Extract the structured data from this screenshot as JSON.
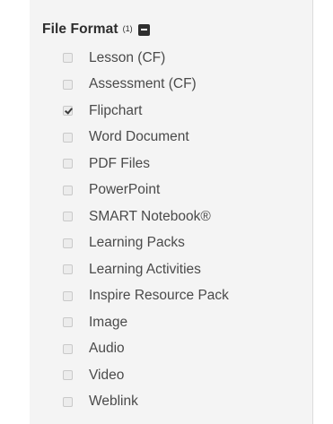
{
  "filter": {
    "title": "File Format",
    "count": "(1)",
    "collapse_icon": "minus-square-icon",
    "options": [
      {
        "label": "Lesson (CF)",
        "checked": false
      },
      {
        "label": "Assessment (CF)",
        "checked": false
      },
      {
        "label": "Flipchart",
        "checked": true
      },
      {
        "label": "Word Document",
        "checked": false
      },
      {
        "label": "PDF Files",
        "checked": false
      },
      {
        "label": "PowerPoint",
        "checked": false
      },
      {
        "label": "SMART Notebook®",
        "checked": false
      },
      {
        "label": "Learning Packs",
        "checked": false
      },
      {
        "label": "Learning Activities",
        "checked": false
      },
      {
        "label": "Inspire Resource Pack",
        "checked": false
      },
      {
        "label": "Image",
        "checked": false
      },
      {
        "label": "Audio",
        "checked": false
      },
      {
        "label": "Video",
        "checked": false
      },
      {
        "label": "Weblink",
        "checked": false
      }
    ]
  }
}
